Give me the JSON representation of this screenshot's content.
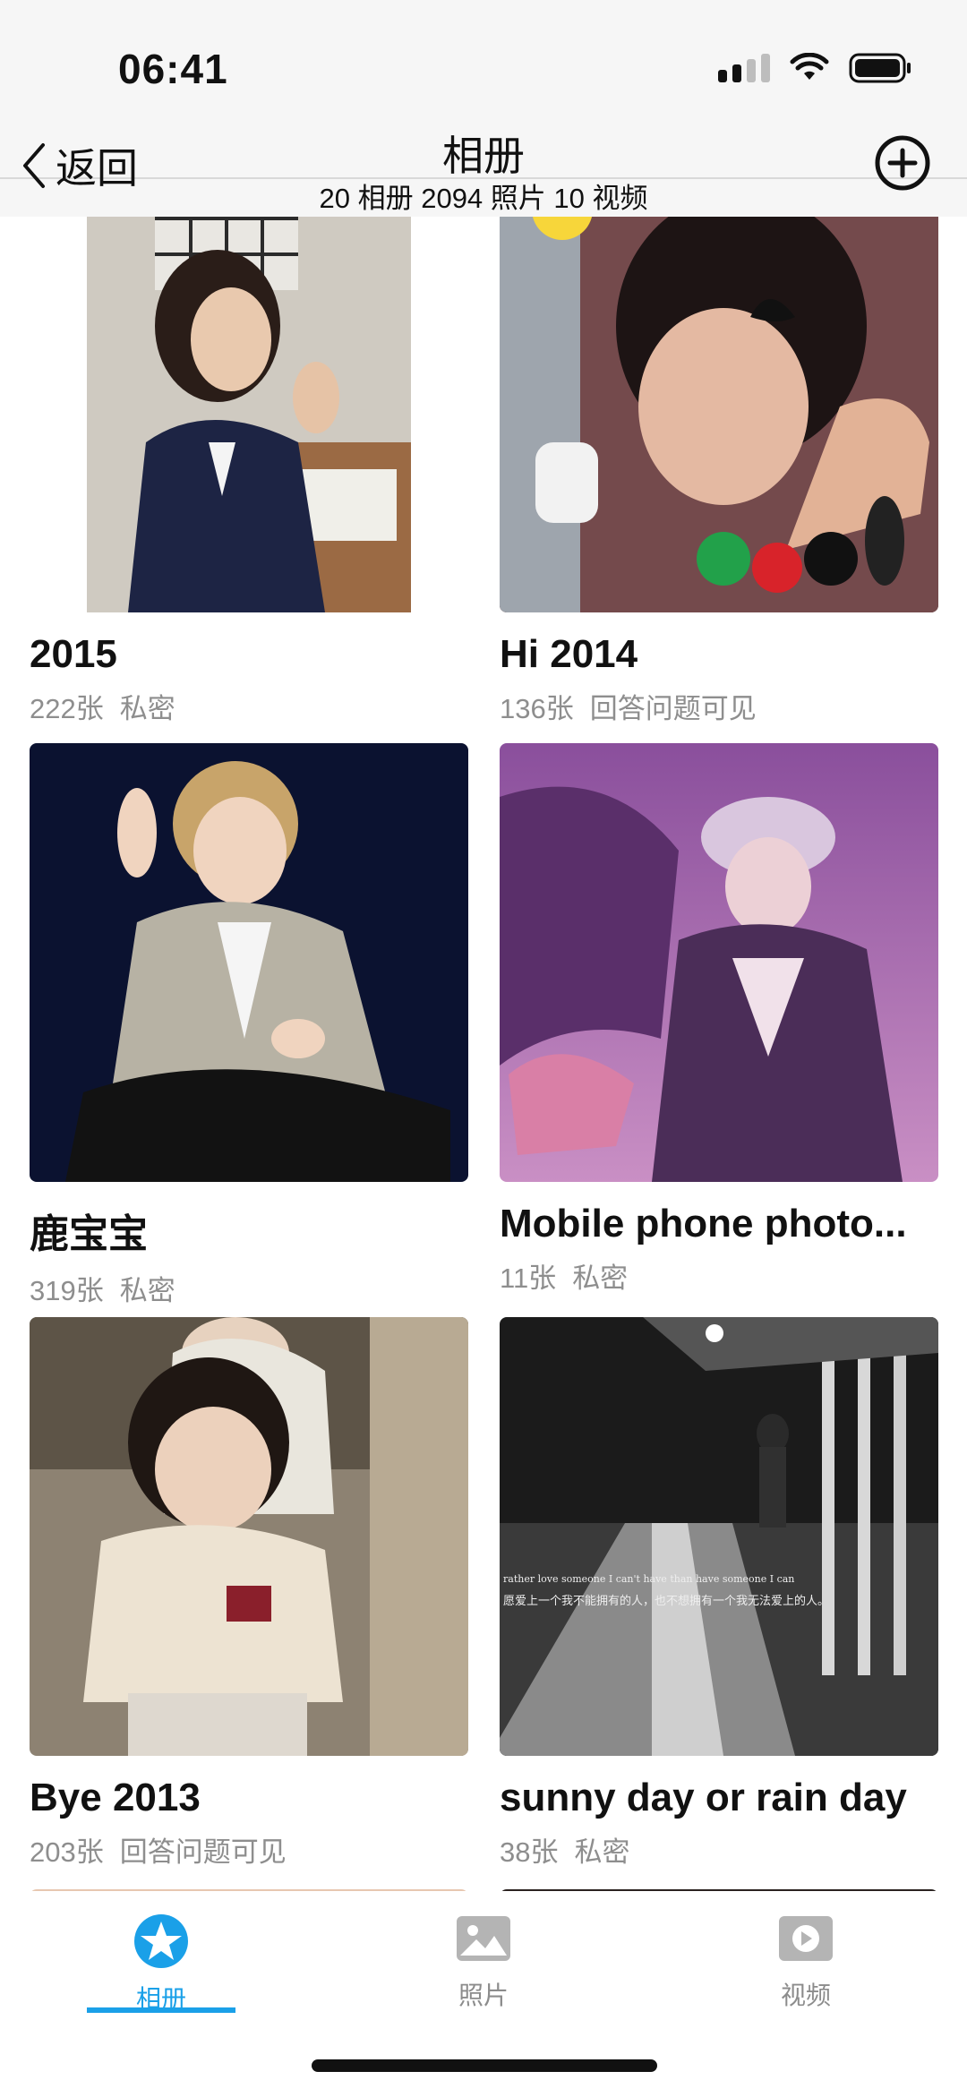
{
  "status": {
    "time": "06:41"
  },
  "nav": {
    "back_label": "返回",
    "title": "相册",
    "subtitle": "20 相册 2094 照片 10 视频"
  },
  "albums": [
    {
      "title": "2015",
      "count": "222张",
      "privacy": "私密"
    },
    {
      "title": "Hi 2014",
      "count": "136张",
      "privacy": "回答问题可见"
    },
    {
      "title": "鹿宝宝",
      "count": "319张",
      "privacy": "私密"
    },
    {
      "title": "Mobile phone photo...",
      "count": "11张",
      "privacy": "私密"
    },
    {
      "title": "Bye 2013",
      "count": "203张",
      "privacy": "回答问题可见"
    },
    {
      "title": "sunny day or rain day",
      "count": "38张",
      "privacy": "私密"
    }
  ],
  "thumb_overlay": {
    "line1": "rather love someone I can't have than have someone I can",
    "line2": "愿爱上一个我不能拥有的人，也不想拥有一个我无法爱上的人。"
  },
  "tabs": [
    {
      "label": "相册",
      "icon": "album-icon",
      "active": true
    },
    {
      "label": "照片",
      "icon": "photo-icon",
      "active": false
    },
    {
      "label": "视频",
      "icon": "video-icon",
      "active": false
    }
  ],
  "colors": {
    "accent": "#1aa0e8",
    "meta_text": "#8e8e8e",
    "bar_bg": "#f6f6f6"
  }
}
